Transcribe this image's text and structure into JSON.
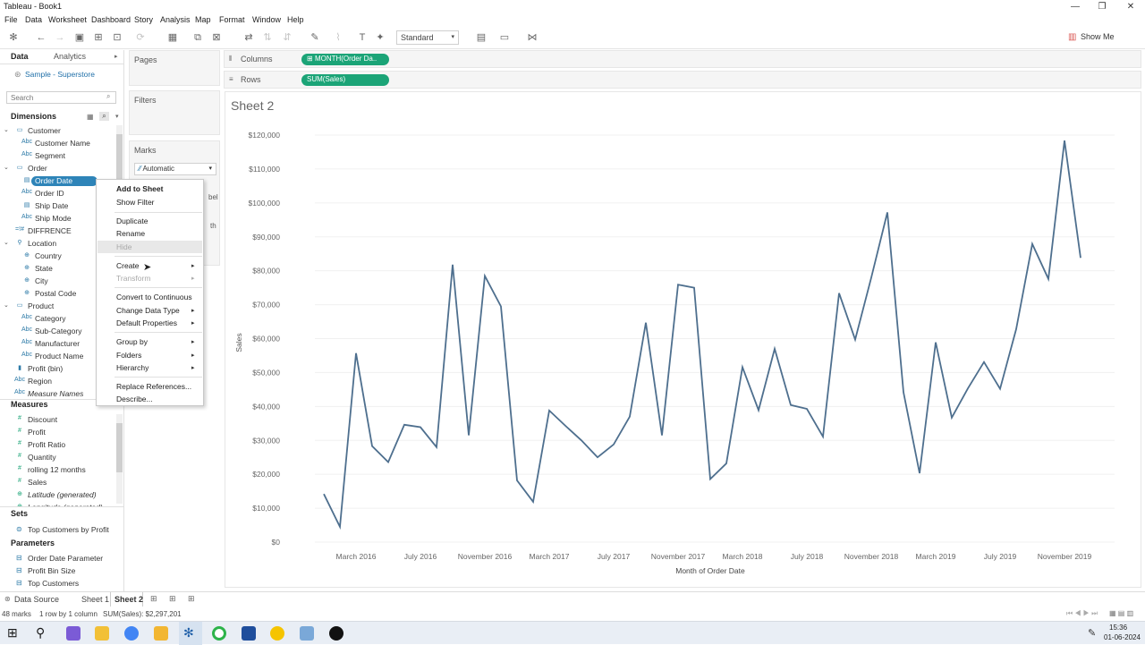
{
  "window": {
    "title": "Tableau - Book1",
    "controls": [
      "—",
      "❐",
      "✕"
    ]
  },
  "menu": [
    "File",
    "Data",
    "Worksheet",
    "Dashboard",
    "Story",
    "Analysis",
    "Map",
    "Format",
    "Window",
    "Help"
  ],
  "toolbar": {
    "fit_select": "Standard",
    "show_me": "Show Me"
  },
  "data_pane": {
    "tabs": {
      "data": "Data",
      "analytics": "Analytics"
    },
    "datasource": "Sample - Superstore",
    "search_placeholder": "Search",
    "dimensions_header": "Dimensions",
    "measures_header": "Measures",
    "sets_header": "Sets",
    "parameters_header": "Parameters",
    "dimensions": [
      {
        "label": "Customer",
        "type": "folder",
        "caret": true
      },
      {
        "label": "Customer Name",
        "type": "Abc"
      },
      {
        "label": "Segment",
        "type": "Abc"
      },
      {
        "label": "Order",
        "type": "folder",
        "caret": true
      },
      {
        "label": "Order Date",
        "type": "date",
        "selected": true
      },
      {
        "label": "Order ID",
        "type": "Abc"
      },
      {
        "label": "Ship Date",
        "type": "date"
      },
      {
        "label": "Ship Mode",
        "type": "Abc"
      },
      {
        "label": "DIFFRENCE",
        "type": "num",
        "top": true
      },
      {
        "label": "Location",
        "type": "geo",
        "caret": true
      },
      {
        "label": "Country",
        "type": "globe"
      },
      {
        "label": "State",
        "type": "globe"
      },
      {
        "label": "City",
        "type": "globe"
      },
      {
        "label": "Postal Code",
        "type": "globe"
      },
      {
        "label": "Product",
        "type": "folder",
        "caret": true
      },
      {
        "label": "Category",
        "type": "Abc"
      },
      {
        "label": "Sub-Category",
        "type": "Abc"
      },
      {
        "label": "Manufacturer",
        "type": "Abc"
      },
      {
        "label": "Product Name",
        "type": "Abc"
      },
      {
        "label": "Profit (bin)",
        "type": "bar",
        "top": true
      },
      {
        "label": "Region",
        "type": "Abc",
        "top": true
      },
      {
        "label": "Measure Names",
        "type": "Abc",
        "top": true,
        "italic": true
      }
    ],
    "measures": [
      {
        "label": "Discount",
        "type": "#"
      },
      {
        "label": "Profit",
        "type": "#"
      },
      {
        "label": "Profit Ratio",
        "type": "#"
      },
      {
        "label": "Quantity",
        "type": "#"
      },
      {
        "label": "rolling 12 months",
        "type": "#"
      },
      {
        "label": "Sales",
        "type": "#"
      },
      {
        "label": "Latitude (generated)",
        "type": "globe",
        "italic": true
      },
      {
        "label": "Longitude (generated)",
        "type": "globe",
        "italic": true
      }
    ],
    "sets": [
      {
        "label": "Top Customers by Profit"
      }
    ],
    "parameters": [
      {
        "label": "Order Date Parameter"
      },
      {
        "label": "Profit Bin Size"
      },
      {
        "label": "Top Customers"
      }
    ]
  },
  "cards": {
    "pages": "Pages",
    "filters": "Filters",
    "marks": "Marks",
    "marks_type": "Automatic",
    "label_fragment": "bel",
    "path_fragment": "th"
  },
  "shelves": {
    "columns_label": "Columns",
    "columns_pill": "MONTH(Order Da..",
    "rows_label": "Rows",
    "rows_pill": "SUM(Sales)"
  },
  "sheet_title": "Sheet 2",
  "context_menu": {
    "items": [
      {
        "label": "Add to Sheet",
        "bold": true
      },
      {
        "label": "Show Filter"
      },
      {
        "sep": true
      },
      {
        "label": "Duplicate"
      },
      {
        "label": "Rename"
      },
      {
        "label": "Hide",
        "disabled": true,
        "highlight": true
      },
      {
        "sep": true
      },
      {
        "label": "Create",
        "submenu": true
      },
      {
        "label": "Transform",
        "submenu": true,
        "disabled": true
      },
      {
        "sep": true
      },
      {
        "label": "Convert to Continuous"
      },
      {
        "label": "Change Data Type",
        "submenu": true
      },
      {
        "label": "Default Properties",
        "submenu": true
      },
      {
        "sep": true
      },
      {
        "label": "Group by",
        "submenu": true
      },
      {
        "label": "Folders",
        "submenu": true
      },
      {
        "label": "Hierarchy",
        "submenu": true
      },
      {
        "sep": true
      },
      {
        "label": "Replace References..."
      },
      {
        "label": "Describe..."
      }
    ]
  },
  "bottom_tabs": {
    "data_source": "Data Source",
    "sheet1": "Sheet 1",
    "sheet2": "Sheet 2"
  },
  "status": {
    "marks": "48 marks",
    "rows_cols": "1 row by 1 column",
    "sum": "SUM(Sales): $2,297,201"
  },
  "clock": {
    "time": "15:36",
    "date": "01-06-2024"
  },
  "chart_data": {
    "type": "line",
    "xlabel": "Month of Order Date",
    "ylabel": "Sales",
    "ylim": [
      0,
      120000
    ],
    "yticks": [
      "$0",
      "$10,000",
      "$20,000",
      "$30,000",
      "$40,000",
      "$50,000",
      "$60,000",
      "$70,000",
      "$80,000",
      "$90,000",
      "$100,000",
      "$110,000",
      "$120,000"
    ],
    "xticks": [
      "March 2016",
      "July 2016",
      "November 2016",
      "March 2017",
      "July 2017",
      "November 2017",
      "March 2018",
      "July 2018",
      "November 2018",
      "March 2019",
      "July 2019",
      "November 2019"
    ],
    "series": [
      {
        "values": [
          14200,
          4500,
          55700,
          28300,
          23600,
          34600,
          33900,
          28000,
          81800,
          31500,
          78500,
          69500,
          18200,
          11900,
          38800,
          34300,
          30000,
          25000,
          28800,
          37000,
          64700,
          31500,
          75900,
          75000,
          18600,
          23200,
          51600,
          38900,
          57000,
          40400,
          39300,
          31100,
          73400,
          59700,
          78000,
          97200,
          44200,
          20300,
          58900,
          36700,
          45300,
          53100,
          45200,
          62800,
          87900,
          77600,
          118400,
          83800
        ]
      }
    ]
  }
}
